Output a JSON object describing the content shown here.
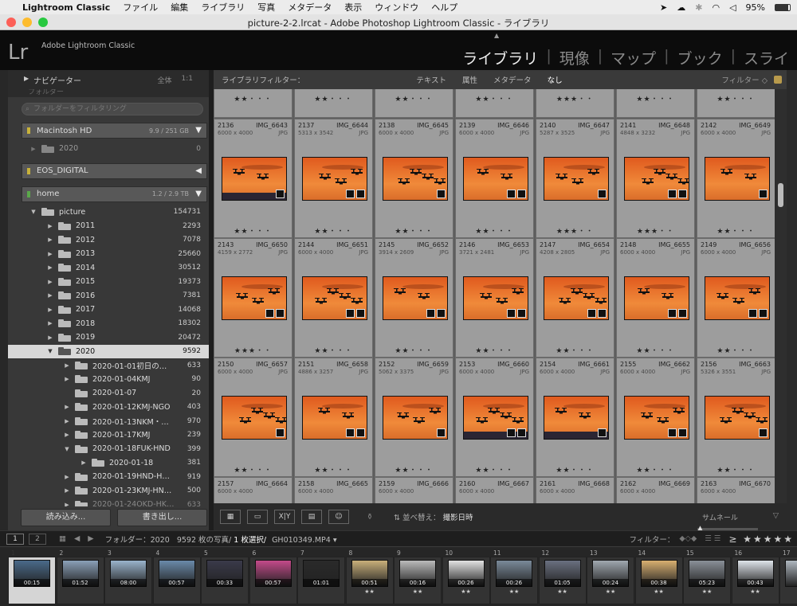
{
  "menubar": {
    "app": "Lightroom Classic",
    "items": [
      "ファイル",
      "編集",
      "ライブラリ",
      "写真",
      "メタデータ",
      "表示",
      "ウィンドウ",
      "ヘルプ"
    ],
    "battery": "95%"
  },
  "window": {
    "title": "picture-2-2.lrcat - Adobe Photoshop Lightroom Classic - ライブラリ"
  },
  "identity": {
    "logo": "Lr",
    "brand": "Adobe Lightroom Classic",
    "caret": "▲"
  },
  "modules": [
    "ライブラリ",
    "現像",
    "マップ",
    "ブック",
    "スライ"
  ],
  "navigator": {
    "label": "ナビゲーター",
    "zooms": [
      "全体",
      "1:1"
    ]
  },
  "folders": {
    "header": "フォルダー",
    "search_placeholder": "フォルダーをフィルタリング",
    "volumes": [
      {
        "name": "Macintosh HD",
        "cap": "9.9 / 251 GB",
        "color": "#c8b23a",
        "arrow": "▼"
      },
      {
        "name": "EOS_DIGITAL",
        "cap": "",
        "color": "#c8b23a",
        "arrow": "◀"
      },
      {
        "name": "home",
        "cap": "1.2 / 2.9 TB",
        "color": "#5aa84a",
        "arrow": "▼"
      }
    ],
    "mac_sub": {
      "name": "2020",
      "count": "0"
    },
    "tree": [
      {
        "name": "picture",
        "count": "154731",
        "tri": "▼",
        "indent": 0
      },
      {
        "name": "2011",
        "count": "2293",
        "tri": "▶",
        "indent": 1
      },
      {
        "name": "2012",
        "count": "7078",
        "tri": "▶",
        "indent": 1
      },
      {
        "name": "2013",
        "count": "25660",
        "tri": "▶",
        "indent": 1
      },
      {
        "name": "2014",
        "count": "30512",
        "tri": "▶",
        "indent": 1
      },
      {
        "name": "2015",
        "count": "19373",
        "tri": "▶",
        "indent": 1
      },
      {
        "name": "2016",
        "count": "7381",
        "tri": "▶",
        "indent": 1
      },
      {
        "name": "2017",
        "count": "14068",
        "tri": "▶",
        "indent": 1
      },
      {
        "name": "2018",
        "count": "18302",
        "tri": "▶",
        "indent": 1
      },
      {
        "name": "2019",
        "count": "20472",
        "tri": "▶",
        "indent": 1
      },
      {
        "name": "2020",
        "count": "9592",
        "tri": "▼",
        "indent": 1,
        "sel": true
      },
      {
        "name": "2020-01-01初日の…",
        "count": "633",
        "tri": "▶",
        "indent": 2
      },
      {
        "name": "2020-01-04KMJ",
        "count": "90",
        "tri": "▶",
        "indent": 2
      },
      {
        "name": "2020-01-07",
        "count": "20",
        "tri": "",
        "indent": 2
      },
      {
        "name": "2020-01-12KMJ-NGO",
        "count": "403",
        "tri": "▶",
        "indent": 2
      },
      {
        "name": "2020-01-13NKM・…",
        "count": "970",
        "tri": "▶",
        "indent": 2
      },
      {
        "name": "2020-01-17KMJ",
        "count": "239",
        "tri": "▶",
        "indent": 2
      },
      {
        "name": "2020-01-18FUK-HND",
        "count": "399",
        "tri": "▼",
        "indent": 2
      },
      {
        "name": "2020-01-18",
        "count": "381",
        "tri": "▶",
        "indent": 3
      },
      {
        "name": "2020-01-19HND-H…",
        "count": "919",
        "tri": "▶",
        "indent": 2
      },
      {
        "name": "2020-01-23KMJ-HN…",
        "count": "500",
        "tri": "▶",
        "indent": 2
      },
      {
        "name": "2020-01-24OKD-HK…",
        "count": "633",
        "tri": "▶",
        "indent": 2,
        "dim": true
      }
    ]
  },
  "buttons": {
    "import": "読み込み...",
    "export": "書き出し..."
  },
  "filterbar": {
    "label": "ライブラリフィルター：",
    "options": [
      "テキスト",
      "属性",
      "メタデータ",
      "なし"
    ],
    "preset": "フィルター ◇"
  },
  "grid": {
    "top_stars": [
      "★★・・・",
      "★★・・・",
      "★★・・・",
      "★★・・・",
      "★★★・・",
      "★★・・・",
      "★★・・・"
    ],
    "rows": [
      [
        {
          "idx": "2136",
          "name": "IMG_6643",
          "dim": "6000 x 4000",
          "ext": "JPG",
          "stars": "★★・・・"
        },
        {
          "idx": "2137",
          "name": "IMG_6644",
          "dim": "5313 x 3542",
          "ext": "JPG",
          "stars": "★★・・・"
        },
        {
          "idx": "2138",
          "name": "IMG_6645",
          "dim": "6000 x 4000",
          "ext": "JPG",
          "stars": "★★・・・"
        },
        {
          "idx": "2139",
          "name": "IMG_6646",
          "dim": "6000 x 4000",
          "ext": "JPG",
          "stars": "★★・・・"
        },
        {
          "idx": "2140",
          "name": "IMG_6647",
          "dim": "5287 x 3525",
          "ext": "JPG",
          "stars": "★★★・・"
        },
        {
          "idx": "2141",
          "name": "IMG_6648",
          "dim": "4848 x 3232",
          "ext": "JPG",
          "stars": "★★★・・"
        },
        {
          "idx": "2142",
          "name": "IMG_6649",
          "dim": "6000 x 4000",
          "ext": "JPG",
          "stars": "★★・・・"
        }
      ],
      [
        {
          "idx": "2143",
          "name": "IMG_6650",
          "dim": "4159 x 2772",
          "ext": "JPG",
          "stars": "★★★・・"
        },
        {
          "idx": "2144",
          "name": "IMG_6651",
          "dim": "6000 x 4000",
          "ext": "JPG",
          "stars": "★★・・・"
        },
        {
          "idx": "2145",
          "name": "IMG_6652",
          "dim": "3914 x 2609",
          "ext": "JPG",
          "stars": "★★・・・"
        },
        {
          "idx": "2146",
          "name": "IMG_6653",
          "dim": "3721 x 2481",
          "ext": "JPG",
          "stars": "★★・・・"
        },
        {
          "idx": "2147",
          "name": "IMG_6654",
          "dim": "4208 x 2805",
          "ext": "JPG",
          "stars": "★★・・・"
        },
        {
          "idx": "2148",
          "name": "IMG_6655",
          "dim": "6000 x 4000",
          "ext": "JPG",
          "stars": "★★・・・"
        },
        {
          "idx": "2149",
          "name": "IMG_6656",
          "dim": "6000 x 4000",
          "ext": "JPG",
          "stars": "★★・・・"
        }
      ],
      [
        {
          "idx": "2150",
          "name": "IMG_6657",
          "dim": "6000 x 4000",
          "ext": "JPG",
          "stars": "★★・・・"
        },
        {
          "idx": "2151",
          "name": "IMG_6658",
          "dim": "4886 x 3257",
          "ext": "JPG",
          "stars": "★★・・・"
        },
        {
          "idx": "2152",
          "name": "IMG_6659",
          "dim": "5062 x 3375",
          "ext": "JPG",
          "stars": "★★・・・"
        },
        {
          "idx": "2153",
          "name": "IMG_6660",
          "dim": "6000 x 4000",
          "ext": "JPG",
          "stars": "★★・・・"
        },
        {
          "idx": "2154",
          "name": "IMG_6661",
          "dim": "6000 x 4000",
          "ext": "JPG",
          "stars": "★★・・・"
        },
        {
          "idx": "2155",
          "name": "IMG_6662",
          "dim": "6000 x 4000",
          "ext": "JPG",
          "stars": "★★・・・"
        },
        {
          "idx": "2156",
          "name": "IMG_6663",
          "dim": "5326 x 3551",
          "ext": "JPG",
          "stars": "★★・・・"
        }
      ],
      [
        {
          "idx": "2157",
          "name": "IMG_6664",
          "dim": "6000 x 4000",
          "ext": "",
          "stars": ""
        },
        {
          "idx": "2158",
          "name": "IMG_6665",
          "dim": "6000 x 4000",
          "ext": "",
          "stars": ""
        },
        {
          "idx": "2159",
          "name": "IMG_6666",
          "dim": "6000 x 4000",
          "ext": "",
          "stars": ""
        },
        {
          "idx": "2160",
          "name": "IMG_6667",
          "dim": "6000 x 4000",
          "ext": "",
          "stars": ""
        },
        {
          "idx": "2161",
          "name": "IMG_6668",
          "dim": "6000 x 4000",
          "ext": "",
          "stars": ""
        },
        {
          "idx": "2162",
          "name": "IMG_6669",
          "dim": "6000 x 4000",
          "ext": "",
          "stars": ""
        },
        {
          "idx": "2163",
          "name": "IMG_6670",
          "dim": "6000 x 4000",
          "ext": "",
          "stars": ""
        }
      ]
    ]
  },
  "toolbar": {
    "sort_label": "並べ替え：",
    "sort_value": "撮影日時",
    "thumb_label": "サムネール",
    "loupe": "X|Y"
  },
  "filmbar": {
    "screen1": "1",
    "screen2": "2",
    "source": "フォルダー：2020",
    "count": "9592 枚の写真/",
    "selected": "1 枚選択/",
    "file": "GH010349.MP4 ▾",
    "filter_label": "フィルター：",
    "stars": "≥ ★★★★★"
  },
  "filmstrip": [
    {
      "n": "1",
      "dur": "00:15",
      "sel": true,
      "st": ""
    },
    {
      "n": "2",
      "dur": "01:52",
      "st": ""
    },
    {
      "n": "3",
      "dur": "08:00",
      "st": ""
    },
    {
      "n": "4",
      "dur": "00:57",
      "st": ""
    },
    {
      "n": "5",
      "dur": "00:33",
      "st": ""
    },
    {
      "n": "6",
      "dur": "00:57",
      "st": ""
    },
    {
      "n": "7",
      "dur": "01:01",
      "st": ""
    },
    {
      "n": "8",
      "dur": "00:51",
      "st": "★★"
    },
    {
      "n": "9",
      "dur": "00:16",
      "st": "★★"
    },
    {
      "n": "10",
      "dur": "00:26",
      "st": "★★"
    },
    {
      "n": "11",
      "dur": "00:26",
      "st": "★★"
    },
    {
      "n": "12",
      "dur": "01:05",
      "st": "★★"
    },
    {
      "n": "13",
      "dur": "00:24",
      "st": "★★"
    },
    {
      "n": "14",
      "dur": "00:38",
      "st": "★★"
    },
    {
      "n": "15",
      "dur": "05:23",
      "st": "★★"
    },
    {
      "n": "16",
      "dur": "00:43",
      "st": "★★"
    },
    {
      "n": "17",
      "dur": "",
      "st": ""
    }
  ]
}
